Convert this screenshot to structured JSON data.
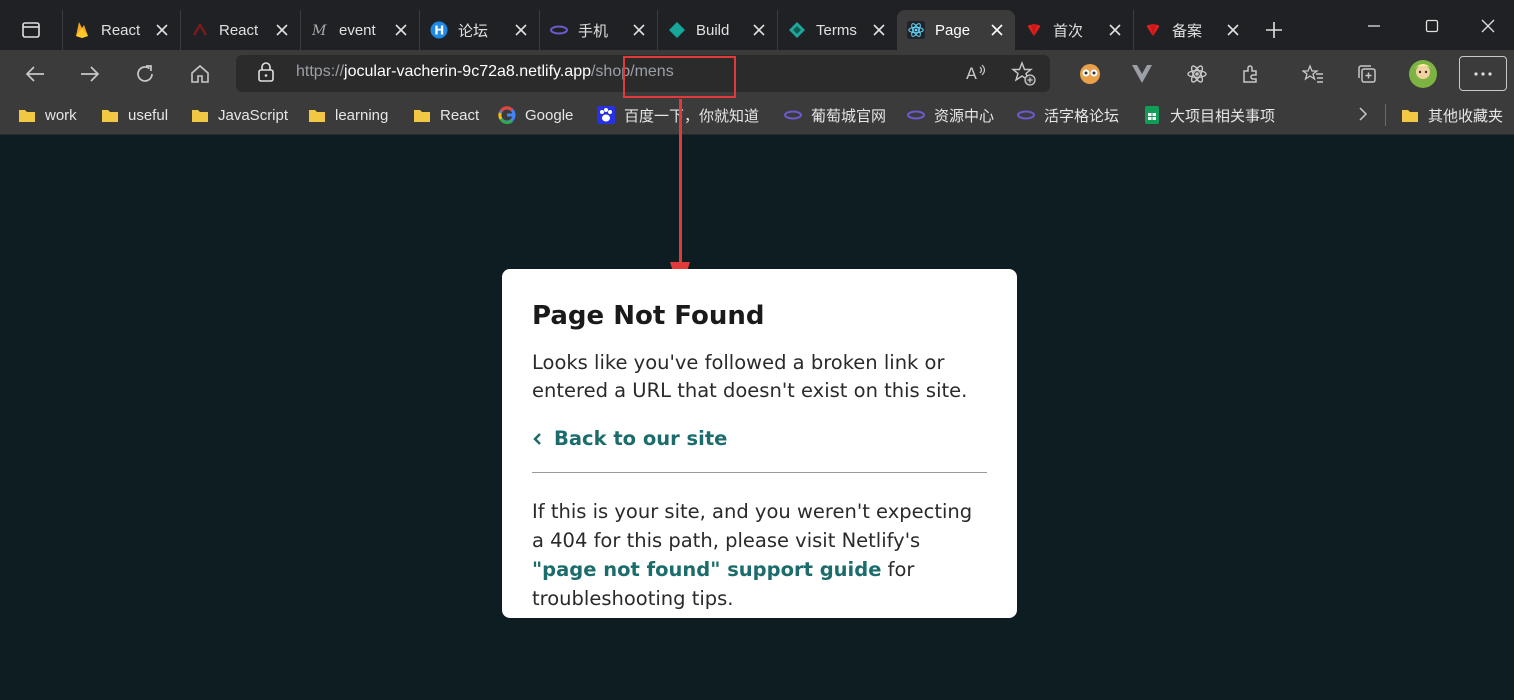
{
  "browser": {
    "tabs": [
      {
        "label": "React",
        "icon": "firebase-icon"
      },
      {
        "label": "React",
        "icon": "dark-logo-icon"
      },
      {
        "label": "event",
        "icon": "medium-icon"
      },
      {
        "label": "论坛",
        "icon": "h-logo-icon"
      },
      {
        "label": "手机",
        "icon": "grape-icon"
      },
      {
        "label": "Build",
        "icon": "netlify-diamond-icon"
      },
      {
        "label": "Terms",
        "icon": "netlify-icon"
      },
      {
        "label": "Page",
        "icon": "react-icon",
        "active": true
      },
      {
        "label": "首次",
        "icon": "huawei-icon"
      },
      {
        "label": "备案",
        "icon": "huawei-icon"
      }
    ],
    "address": {
      "scheme": "https://",
      "host": "jocular-vacherin-9c72a8.netlify.app",
      "path": "/shop/mens"
    },
    "bookmarks": [
      {
        "label": "work",
        "icon": "folder-icon"
      },
      {
        "label": "useful",
        "icon": "folder-icon"
      },
      {
        "label": "JavaScript",
        "icon": "folder-icon"
      },
      {
        "label": "learning",
        "icon": "folder-icon"
      },
      {
        "label": "React",
        "icon": "folder-icon"
      },
      {
        "label": "Google",
        "icon": "google-icon"
      },
      {
        "label": "百度一下，你就知道",
        "icon": "baidu-icon"
      },
      {
        "label": "葡萄城官网",
        "icon": "grape-icon"
      },
      {
        "label": "资源中心",
        "icon": "grape-icon"
      },
      {
        "label": "活字格论坛",
        "icon": "grape-icon"
      },
      {
        "label": "大项目相关事项",
        "icon": "sheets-icon"
      }
    ],
    "other_bookmarks": "其他收藏夹"
  },
  "card": {
    "title": "Page Not Found",
    "intro": "Looks like you've followed a broken link or entered a URL that doesn't exist on this site.",
    "back_link": "Back to our site",
    "help_prefix": "If this is your site, and you weren't expecting a 404 for this path, please visit Netlify's ",
    "help_link": "\"page not found\" support guide",
    "help_suffix": " for troubleshooting tips."
  },
  "colors": {
    "page_bg": "#0d1d22",
    "card_bg": "#ffffff",
    "link": "#1d6c6c",
    "annotation": "#e03a3a"
  }
}
